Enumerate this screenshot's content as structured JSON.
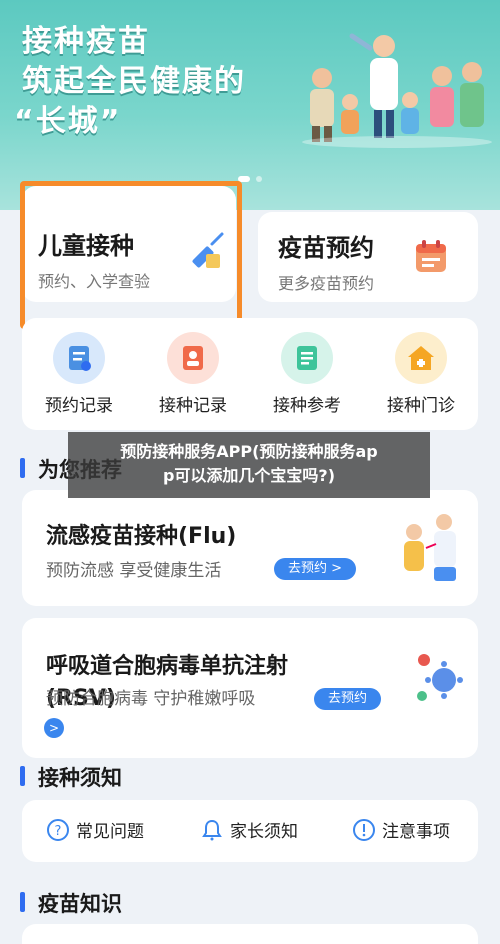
{
  "banner": {
    "line1": "接种疫苗",
    "line2": "筑起全民健康的",
    "line3": "“长城”"
  },
  "services": [
    {
      "title": "儿童接种",
      "subtitle": "预约、入学查验",
      "icon": "syringe-icon"
    },
    {
      "title": "疫苗预约",
      "subtitle": "更多疫苗预约",
      "icon": "calendar-icon"
    }
  ],
  "quick_actions": [
    {
      "label": "预约记录",
      "icon": "appointment-record-icon",
      "color": "#4a90e2"
    },
    {
      "label": "接种记录",
      "icon": "vaccination-record-icon",
      "color": "#f06a4a"
    },
    {
      "label": "接种参考",
      "icon": "reference-icon",
      "color": "#3ec49a"
    },
    {
      "label": "接种门诊",
      "icon": "clinic-icon",
      "color": "#f5a623"
    }
  ],
  "sections": {
    "recommend": "为您推荐",
    "notice": "接种须知",
    "knowledge": "疫苗知识"
  },
  "recommendations": [
    {
      "title": "流感疫苗接种(Flu)",
      "desc": "预防流感 享受健康生活",
      "button": "去预约 >"
    },
    {
      "title": "呼吸道合胞病毒单抗注射",
      "title2": "(RSV)",
      "desc": "预防合胞病毒 守护稚嫩呼吸",
      "button": "去预约",
      "chevron": ">"
    }
  ],
  "notice_items": [
    {
      "label": "常见问题",
      "icon": "question-icon"
    },
    {
      "label": "家长须知",
      "icon": "bell-icon"
    },
    {
      "label": "注意事项",
      "icon": "alert-icon"
    }
  ],
  "overlay": {
    "line1": "预防接种服务APP(预防接种服务ap",
    "line2": "p可以添加几个宝宝吗?)"
  },
  "colors": {
    "accent": "#2f6cf0",
    "highlight": "#f68b2a",
    "banner": "#5cc9c0"
  }
}
